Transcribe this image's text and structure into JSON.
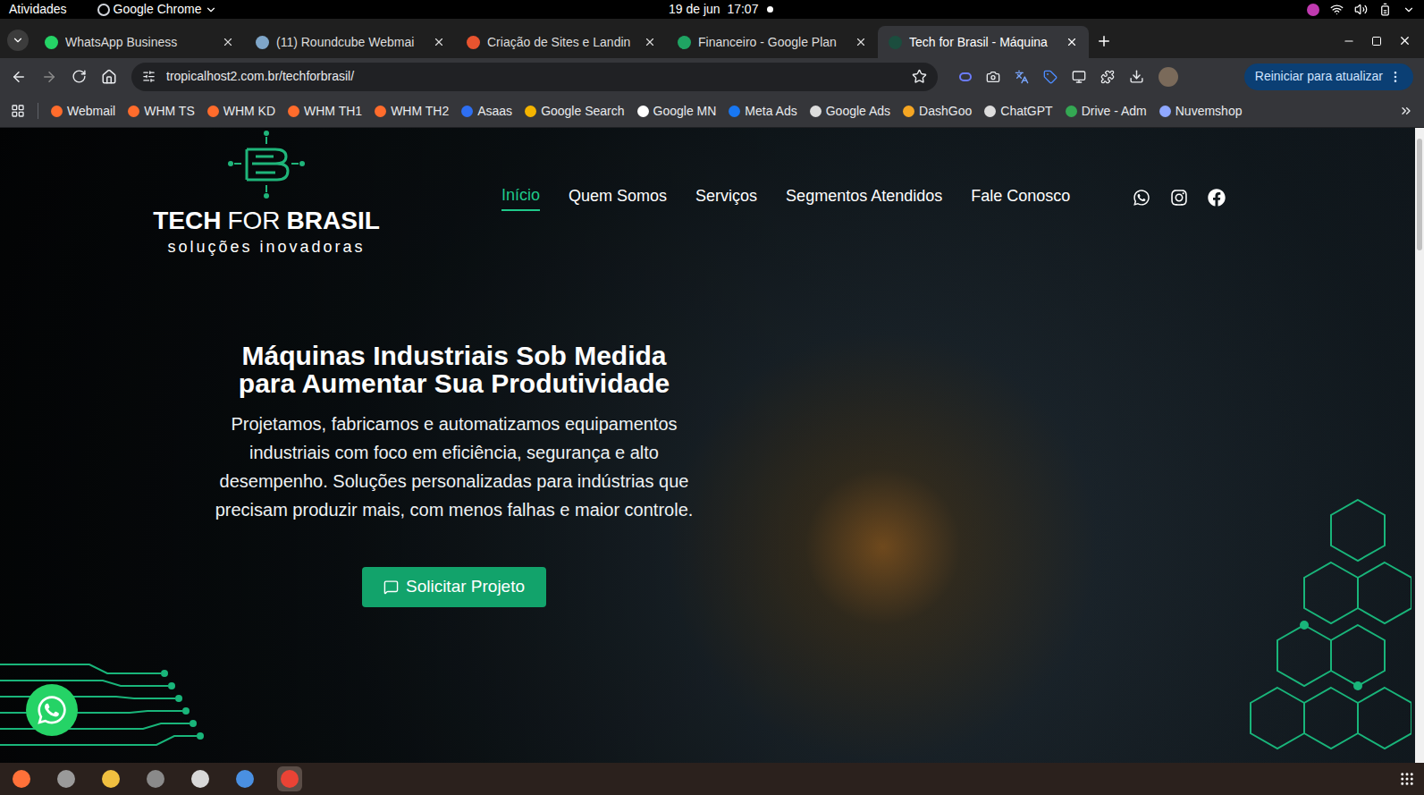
{
  "topbar": {
    "activities": "Atividades",
    "app": "Google Chrome",
    "clock": "19 de jun  17:07"
  },
  "tabs": [
    {
      "label": "WhatsApp Business",
      "selected": false,
      "color": "#25d366"
    },
    {
      "label": "(11) Roundcube Webmai",
      "selected": false,
      "color": "#7fa6c9"
    },
    {
      "label": "Criação de Sites e Landin",
      "selected": false,
      "color": "#e8542f"
    },
    {
      "label": "Financeiro - Google Plan",
      "selected": false,
      "color": "#1fa463"
    },
    {
      "label": "Tech for Brasil - Máquina",
      "selected": true,
      "color": "#1b4d3e"
    }
  ],
  "address": {
    "url": "tropicalhost2.com.br/techforbrasil/",
    "update_button": "Reiniciar para atualizar"
  },
  "bookmarks": [
    {
      "label": "Webmail",
      "color": "#ff6c2c"
    },
    {
      "label": "WHM TS",
      "color": "#ff6c2c"
    },
    {
      "label": "WHM KD",
      "color": "#ff6c2c"
    },
    {
      "label": "WHM TH1",
      "color": "#ff6c2c"
    },
    {
      "label": "WHM TH2",
      "color": "#ff6c2c"
    },
    {
      "label": "Asaas",
      "color": "#2e6ff2"
    },
    {
      "label": "Google Search",
      "color": "#f4b400"
    },
    {
      "label": "Google MN",
      "color": "#ffffff"
    },
    {
      "label": "Meta Ads",
      "color": "#1877f2"
    },
    {
      "label": "Google Ads",
      "color": "#dddddd"
    },
    {
      "label": "DashGoo",
      "color": "#f5a623"
    },
    {
      "label": "ChatGPT",
      "color": "#dddddd"
    },
    {
      "label": "Drive - Adm",
      "color": "#34a853"
    },
    {
      "label": "Nuvemshop",
      "color": "#8fa8ff"
    }
  ],
  "site": {
    "logo": {
      "parts": [
        {
          "text": "TECH",
          "bold": true
        },
        {
          "text": "FOR",
          "bold": false
        },
        {
          "text": "BRASIL",
          "bold": true
        }
      ],
      "tagline": "soluções inovadoras"
    },
    "nav": [
      {
        "label": "Início",
        "selected": true
      },
      {
        "label": "Quem Somos",
        "selected": false
      },
      {
        "label": "Serviços",
        "selected": false
      },
      {
        "label": "Segmentos Atendidos",
        "selected": false
      },
      {
        "label": "Fale Conosco",
        "selected": false
      }
    ],
    "headline": [
      "Máquinas Industriais Sob Medida",
      "para Aumentar Sua Produtividade"
    ],
    "text": "Projetamos, fabricamos e automatizamos equipamentos industriais com foco em eficiência, segurança e alto desempenho. Soluções personalizadas para indústrias que precisam produzir mais, com menos falhas e maior controle.",
    "cta": "Solicitar Projeto"
  },
  "dock": [
    {
      "color": "#ff7139",
      "selected": false
    },
    {
      "color": "#9a9a9a",
      "selected": false
    },
    {
      "color": "#f0c040",
      "selected": false
    },
    {
      "color": "#8a8a8a",
      "selected": false
    },
    {
      "color": "#d8d8d8",
      "selected": false
    },
    {
      "color": "#4a90e2",
      "selected": false
    },
    {
      "color": "#ea4335",
      "selected": true
    }
  ]
}
